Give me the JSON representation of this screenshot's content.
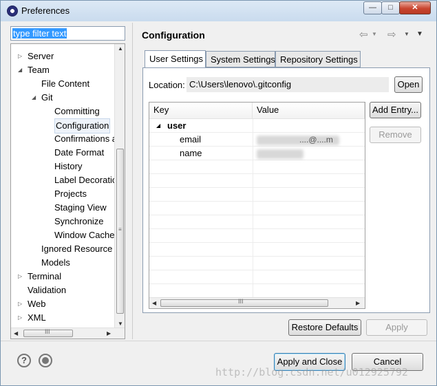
{
  "window": {
    "title": "Preferences",
    "min_glyph": "—",
    "max_glyph": "□",
    "close_glyph": "✕"
  },
  "left": {
    "filter_text": "type filter text",
    "tree": [
      {
        "label": "Server",
        "arrow": "▷",
        "level": 0
      },
      {
        "label": "Team",
        "arrow": "◢",
        "level": 0
      },
      {
        "label": "File Content",
        "arrow": "",
        "level": 1
      },
      {
        "label": "Git",
        "arrow": "◢",
        "level": 1
      },
      {
        "label": "Committing",
        "arrow": "",
        "level": 2
      },
      {
        "label": "Configuration",
        "arrow": "",
        "level": 2,
        "selected": true
      },
      {
        "label": "Confirmations a",
        "arrow": "",
        "level": 2
      },
      {
        "label": "Date Format",
        "arrow": "",
        "level": 2
      },
      {
        "label": "History",
        "arrow": "",
        "level": 2
      },
      {
        "label": "Label Decoratio",
        "arrow": "",
        "level": 2
      },
      {
        "label": "Projects",
        "arrow": "",
        "level": 2
      },
      {
        "label": "Staging View",
        "arrow": "",
        "level": 2
      },
      {
        "label": "Synchronize",
        "arrow": "",
        "level": 2
      },
      {
        "label": "Window Cache",
        "arrow": "",
        "level": 2
      },
      {
        "label": "Ignored Resource",
        "arrow": "",
        "level": 1
      },
      {
        "label": "Models",
        "arrow": "",
        "level": 1
      },
      {
        "label": "Terminal",
        "arrow": "▷",
        "level": 0
      },
      {
        "label": "Validation",
        "arrow": "",
        "level": 0
      },
      {
        "label": "Web",
        "arrow": "▷",
        "level": 0
      },
      {
        "label": "XML",
        "arrow": "▷",
        "level": 0
      }
    ]
  },
  "right": {
    "title": "Configuration",
    "tabs": [
      "User Settings",
      "System Settings",
      "Repository Settings"
    ],
    "location_label": "Location:",
    "location_value": "C:\\Users\\lenovo\\.gitconfig",
    "open_button": "Open",
    "table": {
      "headers": [
        "Key",
        "Value"
      ],
      "rows": [
        {
          "key": "user",
          "value": "",
          "level": 0,
          "arrow": "◢"
        },
        {
          "key": "email",
          "value": "",
          "level": 1,
          "arrow": "",
          "value_fragment": "....@....m"
        },
        {
          "key": "name",
          "value": "",
          "level": 1,
          "arrow": ""
        }
      ]
    },
    "add_entry_button": "Add Entry...",
    "remove_button": "Remove",
    "restore_defaults_button": "Restore Defaults",
    "apply_button": "Apply"
  },
  "footer": {
    "help_glyph": "?",
    "apply_close_button": "Apply and Close",
    "cancel_button": "Cancel",
    "watermark": "http://blog.csdn.net/u012925792"
  }
}
